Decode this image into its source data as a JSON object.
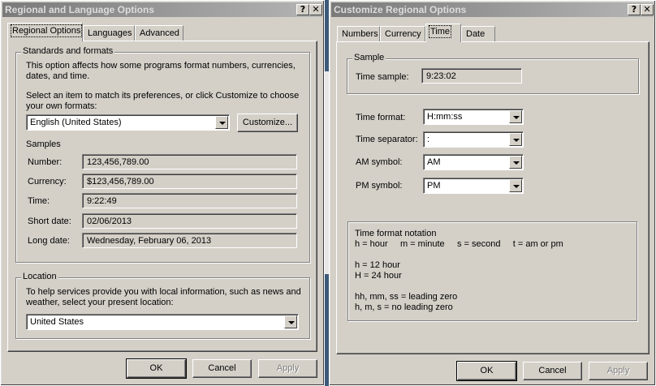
{
  "left_dialog": {
    "title": "Regional and Language Options",
    "help_label": "?",
    "close_label": "✕",
    "tabs": [
      {
        "label": "Regional Options"
      },
      {
        "label": "Languages"
      },
      {
        "label": "Advanced"
      }
    ],
    "standards": {
      "legend": "Standards and formats",
      "description": "This option affects how some programs format numbers, currencies, dates, and time.",
      "select_text": "Select an item to match its preferences, or click Customize to choose your own formats:",
      "format_value": "English (United States)",
      "customize_label": "Customize...",
      "samples_heading": "Samples",
      "samples": [
        {
          "label": "Number:",
          "value": "123,456,789.00"
        },
        {
          "label": "Currency:",
          "value": "$123,456,789.00"
        },
        {
          "label": "Time:",
          "value": "9:22:49"
        },
        {
          "label": "Short date:",
          "value": "02/06/2013"
        },
        {
          "label": "Long date:",
          "value": "Wednesday, February 06, 2013"
        }
      ]
    },
    "location": {
      "legend": "Location",
      "description": "To help services provide you with local information, such as news and weather, select your present location:",
      "value": "United States"
    },
    "buttons": {
      "ok": "OK",
      "cancel": "Cancel",
      "apply": "Apply"
    }
  },
  "right_dialog": {
    "title": "Customize Regional Options",
    "help_label": "?",
    "close_label": "✕",
    "tabs": [
      {
        "label": "Numbers"
      },
      {
        "label": "Currency"
      },
      {
        "label": "Time"
      },
      {
        "label": "Date"
      }
    ],
    "sample": {
      "legend": "Sample",
      "label": "Time sample:",
      "value": "9:23:02"
    },
    "fields": [
      {
        "label": "Time format:",
        "value": "H:mm:ss"
      },
      {
        "label": "Time separator:",
        "value": ":"
      },
      {
        "label": "AM symbol:",
        "value": "AM"
      },
      {
        "label": "PM symbol:",
        "value": "PM"
      }
    ],
    "notation": {
      "heading": "Time format notation",
      "line1": "h = hour     m = minute     s = second     t = am or pm",
      "line2": "h = 12 hour",
      "line3": "H = 24 hour",
      "line4": "hh, mm, ss = leading zero",
      "line5": "h, m, s = no leading zero"
    },
    "buttons": {
      "ok": "OK",
      "cancel": "Cancel",
      "apply": "Apply"
    }
  }
}
